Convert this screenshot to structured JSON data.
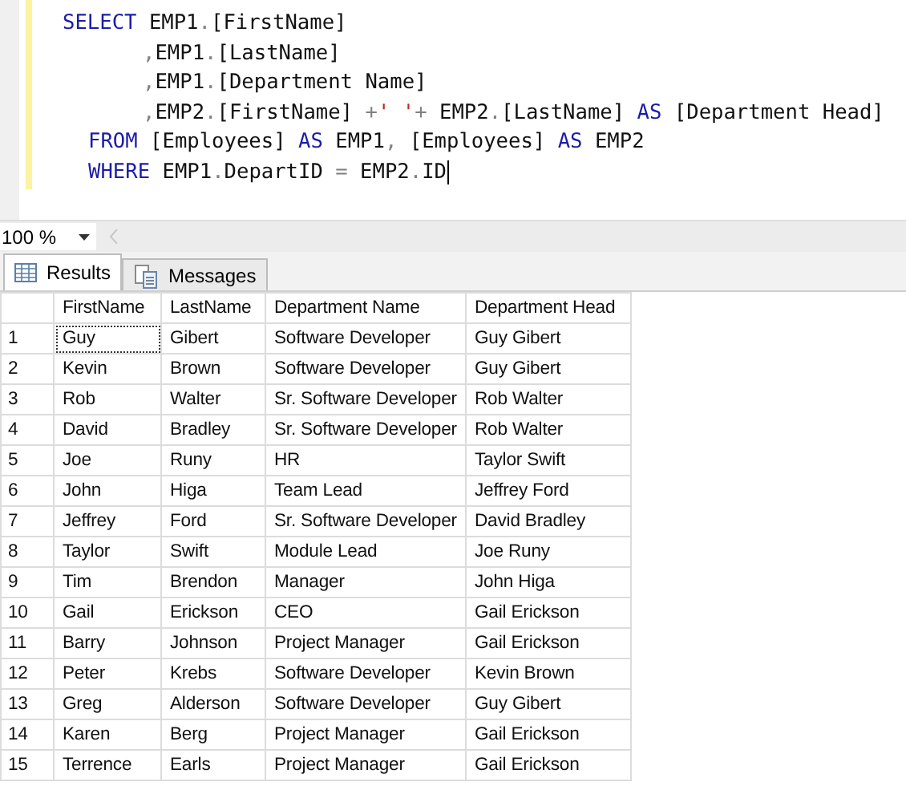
{
  "editor": {
    "lines": [
      {
        "kind": "select",
        "tokens": [
          {
            "text": "SELECT",
            "kind": "keyword"
          },
          {
            "text": " EMP1",
            "kind": "plain"
          },
          {
            "text": ".",
            "kind": "punct"
          },
          {
            "text": "[FirstName]",
            "kind": "plain"
          }
        ]
      },
      {
        "kind": "column",
        "tokens": [
          {
            "text": ",",
            "kind": "punct"
          },
          {
            "text": "EMP1",
            "kind": "plain"
          },
          {
            "text": ".",
            "kind": "punct"
          },
          {
            "text": "[LastName]",
            "kind": "plain"
          }
        ]
      },
      {
        "kind": "column",
        "tokens": [
          {
            "text": ",",
            "kind": "punct"
          },
          {
            "text": "EMP1",
            "kind": "plain"
          },
          {
            "text": ".",
            "kind": "punct"
          },
          {
            "text": "[Department Name]",
            "kind": "plain"
          }
        ]
      },
      {
        "kind": "column",
        "tokens": [
          {
            "text": ",",
            "kind": "punct"
          },
          {
            "text": "EMP2",
            "kind": "plain"
          },
          {
            "text": ".",
            "kind": "punct"
          },
          {
            "text": "[FirstName] ",
            "kind": "plain"
          },
          {
            "text": "+",
            "kind": "punct"
          },
          {
            "text": "' '",
            "kind": "string"
          },
          {
            "text": "+",
            "kind": "punct"
          },
          {
            "text": " EMP2",
            "kind": "plain"
          },
          {
            "text": ".",
            "kind": "punct"
          },
          {
            "text": "[LastName] ",
            "kind": "plain"
          },
          {
            "text": "AS",
            "kind": "keyword"
          },
          {
            "text": " [Department Head]",
            "kind": "plain"
          }
        ]
      },
      {
        "kind": "clause",
        "tokens": [
          {
            "text": "FROM",
            "kind": "keyword"
          },
          {
            "text": " [Employees] ",
            "kind": "plain"
          },
          {
            "text": "AS",
            "kind": "keyword"
          },
          {
            "text": " EMP1",
            "kind": "plain"
          },
          {
            "text": ",",
            "kind": "punct"
          },
          {
            "text": " [Employees] ",
            "kind": "plain"
          },
          {
            "text": "AS",
            "kind": "keyword"
          },
          {
            "text": " EMP2",
            "kind": "plain"
          }
        ]
      },
      {
        "kind": "clause",
        "cursor": true,
        "tokens": [
          {
            "text": "WHERE",
            "kind": "keyword"
          },
          {
            "text": " EMP1",
            "kind": "plain"
          },
          {
            "text": ".",
            "kind": "punct"
          },
          {
            "text": "DepartID ",
            "kind": "plain"
          },
          {
            "text": "=",
            "kind": "punct"
          },
          {
            "text": " EMP2",
            "kind": "plain"
          },
          {
            "text": ".",
            "kind": "punct"
          },
          {
            "text": "ID",
            "kind": "plain"
          }
        ]
      }
    ]
  },
  "zoom": {
    "value": "100 %"
  },
  "tabs": [
    {
      "label": "Results",
      "selected": true
    },
    {
      "label": "Messages",
      "selected": false
    }
  ],
  "grid": {
    "columns": [
      "FirstName",
      "LastName",
      "Department Name",
      "Department Head"
    ],
    "rows": [
      {
        "number": "1",
        "cells": [
          {
            "text": "Guy",
            "focused": true
          },
          {
            "text": "Gibert",
            "focused": false
          },
          {
            "text": "Software Developer",
            "focused": false
          },
          {
            "text": "Guy Gibert",
            "focused": false
          }
        ]
      },
      {
        "number": "2",
        "cells": [
          {
            "text": "Kevin",
            "focused": false
          },
          {
            "text": "Brown",
            "focused": false
          },
          {
            "text": "Software Developer",
            "focused": false
          },
          {
            "text": "Guy Gibert",
            "focused": false
          }
        ]
      },
      {
        "number": "3",
        "cells": [
          {
            "text": "Rob",
            "focused": false
          },
          {
            "text": "Walter",
            "focused": false
          },
          {
            "text": "Sr. Software Developer",
            "focused": false
          },
          {
            "text": "Rob Walter",
            "focused": false
          }
        ]
      },
      {
        "number": "4",
        "cells": [
          {
            "text": "David",
            "focused": false
          },
          {
            "text": "Bradley",
            "focused": false
          },
          {
            "text": "Sr. Software Developer",
            "focused": false
          },
          {
            "text": "Rob Walter",
            "focused": false
          }
        ]
      },
      {
        "number": "5",
        "cells": [
          {
            "text": "Joe",
            "focused": false
          },
          {
            "text": "Runy",
            "focused": false
          },
          {
            "text": "HR",
            "focused": false
          },
          {
            "text": "Taylor Swift",
            "focused": false
          }
        ]
      },
      {
        "number": "6",
        "cells": [
          {
            "text": "John",
            "focused": false
          },
          {
            "text": "Higa",
            "focused": false
          },
          {
            "text": "Team Lead",
            "focused": false
          },
          {
            "text": "Jeffrey Ford",
            "focused": false
          }
        ]
      },
      {
        "number": "7",
        "cells": [
          {
            "text": "Jeffrey",
            "focused": false
          },
          {
            "text": "Ford",
            "focused": false
          },
          {
            "text": "Sr. Software Developer",
            "focused": false
          },
          {
            "text": "David Bradley",
            "focused": false
          }
        ]
      },
      {
        "number": "8",
        "cells": [
          {
            "text": "Taylor",
            "focused": false
          },
          {
            "text": "Swift",
            "focused": false
          },
          {
            "text": "Module Lead",
            "focused": false
          },
          {
            "text": "Joe Runy",
            "focused": false
          }
        ]
      },
      {
        "number": "9",
        "cells": [
          {
            "text": "Tim",
            "focused": false
          },
          {
            "text": "Brendon",
            "focused": false
          },
          {
            "text": "Manager",
            "focused": false
          },
          {
            "text": "John Higa",
            "focused": false
          }
        ]
      },
      {
        "number": "10",
        "cells": [
          {
            "text": "Gail",
            "focused": false
          },
          {
            "text": "Erickson",
            "focused": false
          },
          {
            "text": "CEO",
            "focused": false
          },
          {
            "text": "Gail Erickson",
            "focused": false
          }
        ]
      },
      {
        "number": "11",
        "cells": [
          {
            "text": "Barry",
            "focused": false
          },
          {
            "text": "Johnson",
            "focused": false
          },
          {
            "text": "Project Manager",
            "focused": false
          },
          {
            "text": "Gail Erickson",
            "focused": false
          }
        ]
      },
      {
        "number": "12",
        "cells": [
          {
            "text": "Peter",
            "focused": false
          },
          {
            "text": "Krebs",
            "focused": false
          },
          {
            "text": "Software Developer",
            "focused": false
          },
          {
            "text": "Kevin Brown",
            "focused": false
          }
        ]
      },
      {
        "number": "13",
        "cells": [
          {
            "text": "Greg",
            "focused": false
          },
          {
            "text": "Alderson",
            "focused": false
          },
          {
            "text": "Software Developer",
            "focused": false
          },
          {
            "text": "Guy Gibert",
            "focused": false
          }
        ]
      },
      {
        "number": "14",
        "cells": [
          {
            "text": "Karen",
            "focused": false
          },
          {
            "text": "Berg",
            "focused": false
          },
          {
            "text": "Project Manager",
            "focused": false
          },
          {
            "text": "Gail Erickson",
            "focused": false
          }
        ]
      },
      {
        "number": "15",
        "cells": [
          {
            "text": "Terrence",
            "focused": false
          },
          {
            "text": "Earls",
            "focused": false
          },
          {
            "text": "Project Manager",
            "focused": false
          },
          {
            "text": "Gail Erickson",
            "focused": false
          }
        ]
      }
    ]
  }
}
